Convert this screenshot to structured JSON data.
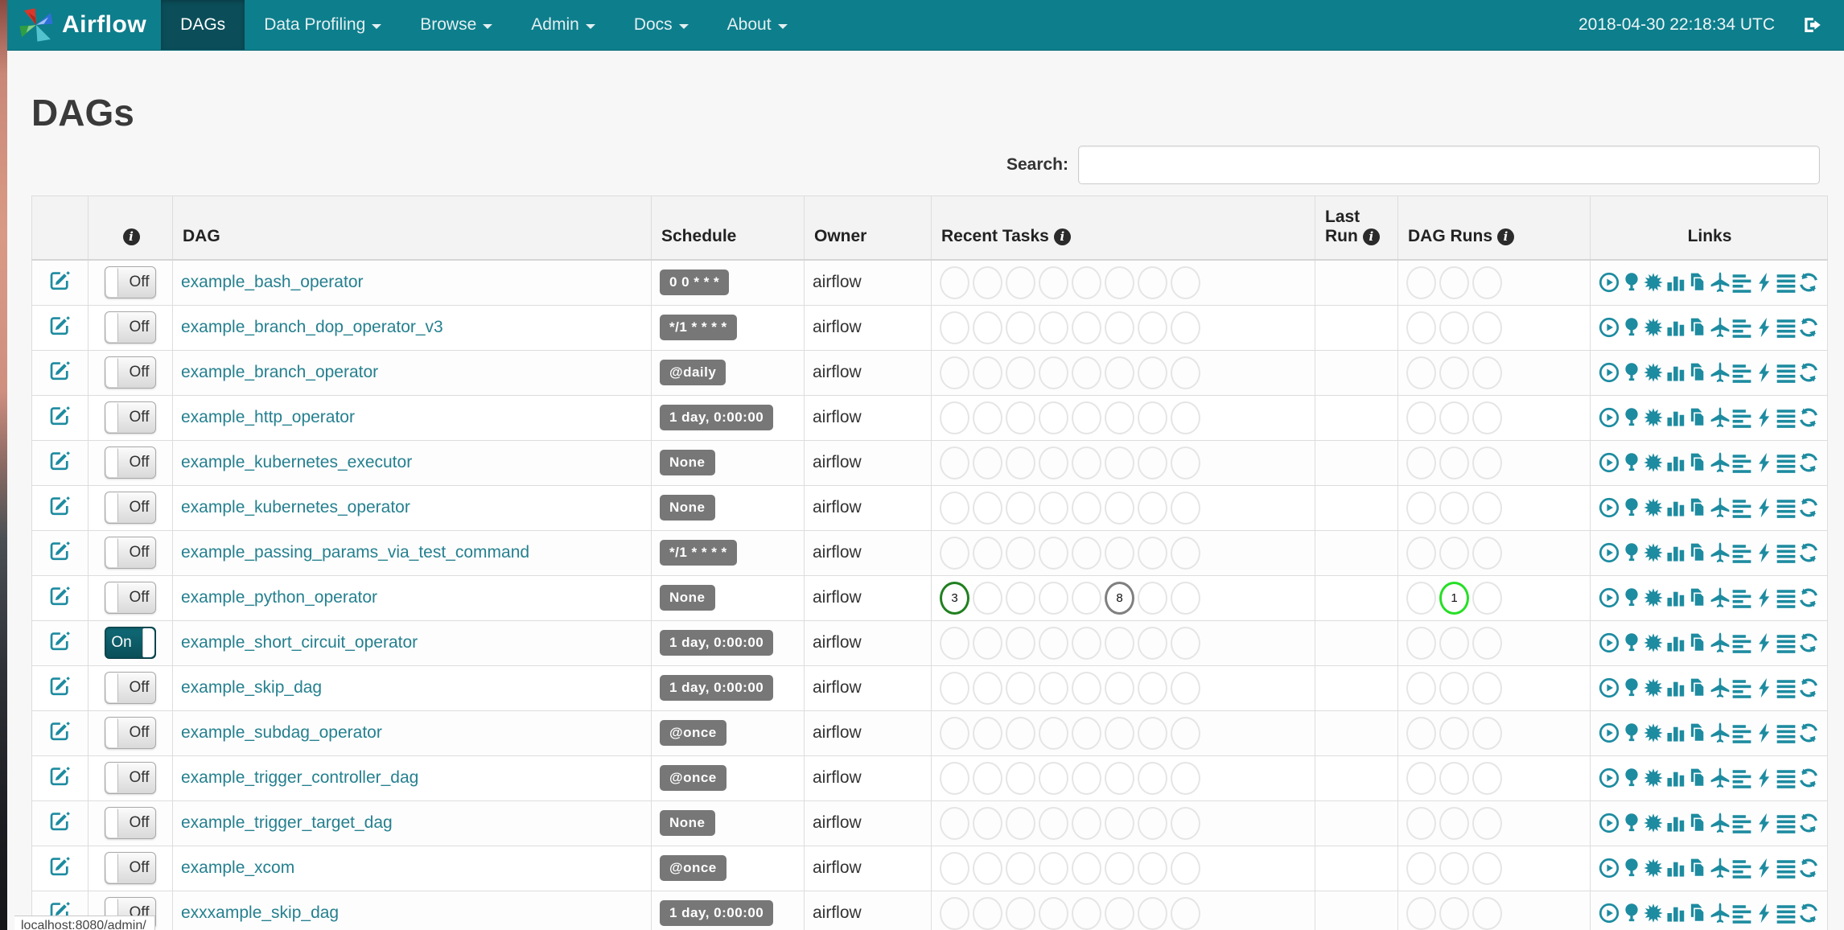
{
  "navbar": {
    "brand": "Airflow",
    "clock": "2018-04-30 22:18:34 UTC",
    "items": [
      {
        "label": "DAGs",
        "active": true,
        "dropdown": false
      },
      {
        "label": "Data Profiling",
        "active": false,
        "dropdown": true
      },
      {
        "label": "Browse",
        "active": false,
        "dropdown": true
      },
      {
        "label": "Admin",
        "active": false,
        "dropdown": true
      },
      {
        "label": "Docs",
        "active": false,
        "dropdown": true
      },
      {
        "label": "About",
        "active": false,
        "dropdown": true
      }
    ]
  },
  "page": {
    "title": "DAGs",
    "search_label": "Search:",
    "search_value": "",
    "status_bar": "localhost:8080/admin/"
  },
  "table": {
    "headers": {
      "dag": "DAG",
      "schedule": "Schedule",
      "owner": "Owner",
      "recent_tasks": "Recent Tasks",
      "last_run_line1": "Last",
      "last_run_line2": "Run",
      "dag_runs": "DAG Runs",
      "links": "Links"
    },
    "links_icons": [
      "trigger-dag",
      "tree-view",
      "graph-view",
      "task-duration",
      "task-tries",
      "landing-times",
      "gantt-view",
      "code-view",
      "logs",
      "refresh"
    ],
    "recent_task_slots": 8,
    "dag_run_slots": 3,
    "rows": [
      {
        "name": "example_bash_operator",
        "toggle": "Off",
        "schedule": "0 0 * * *",
        "owner": "airflow",
        "recent_tasks": [],
        "dag_runs": []
      },
      {
        "name": "example_branch_dop_operator_v3",
        "toggle": "Off",
        "schedule": "*/1 * * * *",
        "owner": "airflow",
        "recent_tasks": [],
        "dag_runs": []
      },
      {
        "name": "example_branch_operator",
        "toggle": "Off",
        "schedule": "@daily",
        "owner": "airflow",
        "recent_tasks": [],
        "dag_runs": []
      },
      {
        "name": "example_http_operator",
        "toggle": "Off",
        "schedule": "1 day, 0:00:00",
        "owner": "airflow",
        "recent_tasks": [],
        "dag_runs": []
      },
      {
        "name": "example_kubernetes_executor",
        "toggle": "Off",
        "schedule": "None",
        "owner": "airflow",
        "recent_tasks": [],
        "dag_runs": []
      },
      {
        "name": "example_kubernetes_operator",
        "toggle": "Off",
        "schedule": "None",
        "owner": "airflow",
        "recent_tasks": [],
        "dag_runs": []
      },
      {
        "name": "example_passing_params_via_test_command",
        "toggle": "Off",
        "schedule": "*/1 * * * *",
        "owner": "airflow",
        "recent_tasks": [],
        "dag_runs": []
      },
      {
        "name": "example_python_operator",
        "toggle": "Off",
        "schedule": "None",
        "owner": "airflow",
        "recent_tasks": [
          {
            "slot": 0,
            "count": "3",
            "state": "success"
          },
          {
            "slot": 5,
            "count": "8",
            "state": "queued"
          }
        ],
        "dag_runs": [
          {
            "slot": 1,
            "count": "1",
            "state": "running"
          }
        ]
      },
      {
        "name": "example_short_circuit_operator",
        "toggle": "On",
        "schedule": "1 day, 0:00:00",
        "owner": "airflow",
        "recent_tasks": [],
        "dag_runs": []
      },
      {
        "name": "example_skip_dag",
        "toggle": "Off",
        "schedule": "1 day, 0:00:00",
        "owner": "airflow",
        "recent_tasks": [],
        "dag_runs": []
      },
      {
        "name": "example_subdag_operator",
        "toggle": "Off",
        "schedule": "@once",
        "owner": "airflow",
        "recent_tasks": [],
        "dag_runs": []
      },
      {
        "name": "example_trigger_controller_dag",
        "toggle": "Off",
        "schedule": "@once",
        "owner": "airflow",
        "recent_tasks": [],
        "dag_runs": []
      },
      {
        "name": "example_trigger_target_dag",
        "toggle": "Off",
        "schedule": "None",
        "owner": "airflow",
        "recent_tasks": [],
        "dag_runs": []
      },
      {
        "name": "example_xcom",
        "toggle": "Off",
        "schedule": "@once",
        "owner": "airflow",
        "recent_tasks": [],
        "dag_runs": []
      },
      {
        "name": "exxxample_skip_dag",
        "toggle": "Off",
        "schedule": "1 day, 0:00:00",
        "owner": "airflow",
        "recent_tasks": [],
        "dag_runs": []
      }
    ]
  },
  "colors": {
    "navbar": "#0d7e8c",
    "navbar_active": "#0b4e59",
    "link_teal": "#1d8ba0",
    "success": "#208020",
    "queued": "#808080",
    "running": "#26df26"
  }
}
